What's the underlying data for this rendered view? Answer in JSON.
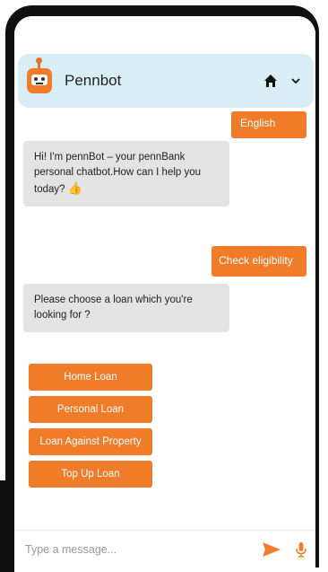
{
  "header": {
    "bot_name": "Pennbot"
  },
  "messages": {
    "user_lang": "English",
    "bot_greeting": "Hi! I'm pennBot – your pennBank personal chatbot.How can I help you today?",
    "user_check": "Check eligibility",
    "bot_choose": "Please choose a loan which you're looking for ?"
  },
  "options": [
    {
      "label": "Home Loan"
    },
    {
      "label": "Personal Loan"
    },
    {
      "label": "Loan Against Property"
    },
    {
      "label": "Top Up Loan"
    }
  ],
  "input": {
    "placeholder": "Type a message..."
  },
  "colors": {
    "accent": "#f07c2a",
    "header_bg": "#d9eef4",
    "bot_bubble": "#e3e3e3",
    "frame": "#111111"
  },
  "icons": {
    "bot": "robot-avatar-icon",
    "home": "home-icon",
    "chevron": "chevron-down-icon",
    "thumb": "thumbs-up-emoji",
    "send": "send-icon",
    "mic": "microphone-icon"
  }
}
